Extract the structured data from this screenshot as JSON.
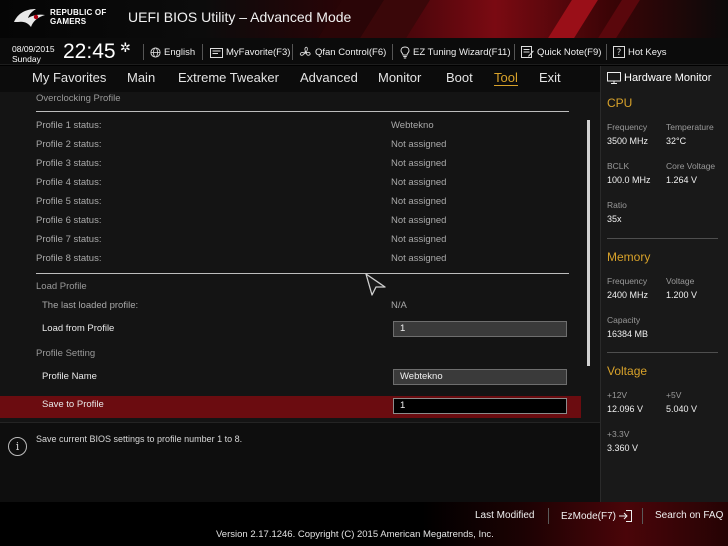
{
  "brand": {
    "line1": "REPUBLIC OF",
    "line2": "GAMERS"
  },
  "app_title": "UEFI BIOS Utility – Advanced Mode",
  "clock": {
    "date": "08/09/2015",
    "day": "Sunday",
    "time": "22:45"
  },
  "toolbar": [
    {
      "label": "English",
      "icon": "globe-icon"
    },
    {
      "label": "MyFavorite(F3)",
      "icon": "my-favorite-icon"
    },
    {
      "label": "Qfan Control(F6)",
      "icon": "fan-icon"
    },
    {
      "label": "EZ Tuning Wizard(F11)",
      "icon": "lightbulb-icon"
    },
    {
      "label": "Quick Note(F9)",
      "icon": "note-icon"
    },
    {
      "label": "Hot Keys",
      "icon": "hotkeys-icon"
    }
  ],
  "menu": [
    "My Favorites",
    "Main",
    "Extreme Tweaker",
    "Advanced",
    "Monitor",
    "Boot",
    "Tool",
    "Exit"
  ],
  "active_menu": "Tool",
  "overclocking": {
    "title": "Overclocking Profile",
    "profiles": [
      {
        "label": "Profile 1 status:",
        "value": "Webtekno"
      },
      {
        "label": "Profile 2 status:",
        "value": "Not assigned"
      },
      {
        "label": "Profile 3 status:",
        "value": "Not assigned"
      },
      {
        "label": "Profile 4 status:",
        "value": "Not assigned"
      },
      {
        "label": "Profile 5 status:",
        "value": "Not assigned"
      },
      {
        "label": "Profile 6 status:",
        "value": "Not assigned"
      },
      {
        "label": "Profile 7 status:",
        "value": "Not assigned"
      },
      {
        "label": "Profile 8 status:",
        "value": "Not assigned"
      }
    ]
  },
  "load_profile": {
    "title": "Load Profile",
    "last_loaded_label": "The last loaded profile:",
    "last_loaded_value": "N/A",
    "load_from_label": "Load from Profile",
    "load_from_value": "1"
  },
  "profile_setting": {
    "title": "Profile Setting",
    "name_label": "Profile Name",
    "name_value": "Webtekno",
    "save_label": "Save to Profile",
    "save_value": "1"
  },
  "help_text": "Save current BIOS settings to profile number 1 to 8.",
  "hardware_monitor": {
    "title": "Hardware Monitor",
    "cpu": {
      "title": "CPU",
      "frequency_label": "Frequency",
      "frequency": "3500 MHz",
      "temperature_label": "Temperature",
      "temperature": "32°C",
      "bclk_label": "BCLK",
      "bclk": "100.0 MHz",
      "core_voltage_label": "Core Voltage",
      "core_voltage": "1.264 V",
      "ratio_label": "Ratio",
      "ratio": "35x"
    },
    "memory": {
      "title": "Memory",
      "frequency_label": "Frequency",
      "frequency": "2400 MHz",
      "voltage_label": "Voltage",
      "voltage": "1.200 V",
      "capacity_label": "Capacity",
      "capacity": "16384 MB"
    },
    "voltage": {
      "title": "Voltage",
      "v12_label": "+12V",
      "v12": "12.096 V",
      "v5_label": "+5V",
      "v5": "5.040 V",
      "v33_label": "+3.3V",
      "v33": "3.360 V"
    }
  },
  "bottom": {
    "last_modified": "Last Modified",
    "ezmode": "EzMode(F7)",
    "search": "Search on FAQ",
    "version": "Version 2.17.1246. Copyright (C) 2015 American Megatrends, Inc."
  },
  "colors": {
    "accent": "#d8a22a",
    "highlight_row": "#6b0c10",
    "brand_red": "#7a0a12"
  }
}
